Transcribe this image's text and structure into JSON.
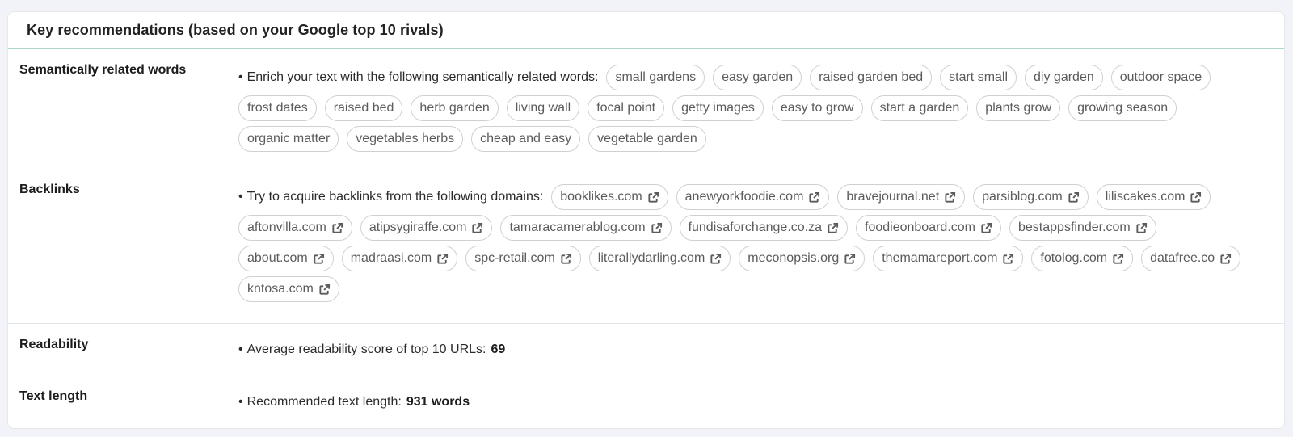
{
  "card": {
    "title": "Key recommendations (based on your Google top 10 rivals)",
    "accent_color": "#a9d8c6"
  },
  "sections": {
    "semantic": {
      "label": "Semantically related words",
      "intro": "Enrich your text with the following semantically related words:",
      "words": [
        "small gardens",
        "easy garden",
        "raised garden bed",
        "start small",
        "diy garden",
        "outdoor space",
        "frost dates",
        "raised bed",
        "herb garden",
        "living wall",
        "focal point",
        "getty images",
        "easy to grow",
        "start a garden",
        "plants grow",
        "growing season",
        "organic matter",
        "vegetables herbs",
        "cheap and easy",
        "vegetable garden"
      ]
    },
    "backlinks": {
      "label": "Backlinks",
      "intro": "Try to acquire backlinks from the following domains:",
      "link_icon": "external-link-icon",
      "domains": [
        "booklikes.com",
        "anewyorkfoodie.com",
        "bravejournal.net",
        "parsiblog.com",
        "liliscakes.com",
        "aftonvilla.com",
        "atipsygiraffe.com",
        "tamaracamerablog.com",
        "fundisaforchange.co.za",
        "foodieonboard.com",
        "bestappsfinder.com",
        "about.com",
        "madraasi.com",
        "spc-retail.com",
        "literallydarling.com",
        "meconopsis.org",
        "themamareport.com",
        "fotolog.com",
        "datafree.co",
        "kntosa.com"
      ]
    },
    "readability": {
      "label": "Readability",
      "text": "Average readability score of top 10 URLs:",
      "value": "69"
    },
    "text_length": {
      "label": "Text length",
      "text": "Recommended text length:",
      "value": "931 words"
    }
  },
  "bullet": "•"
}
